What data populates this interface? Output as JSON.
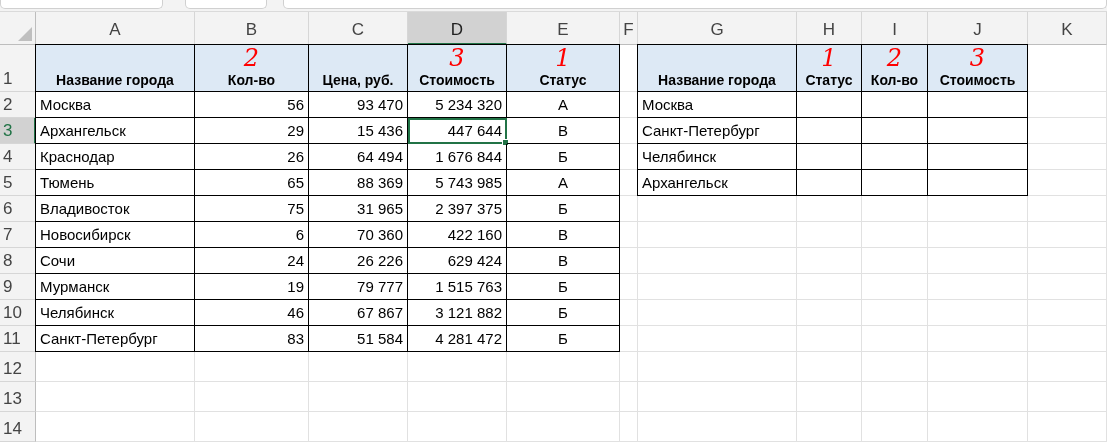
{
  "columns": [
    {
      "label": "A",
      "selected": false
    },
    {
      "label": "B",
      "selected": false
    },
    {
      "label": "C",
      "selected": false
    },
    {
      "label": "D",
      "selected": true
    },
    {
      "label": "E",
      "selected": false
    },
    {
      "label": "F",
      "selected": false
    },
    {
      "label": "G",
      "selected": false
    },
    {
      "label": "H",
      "selected": false
    },
    {
      "label": "I",
      "selected": false
    },
    {
      "label": "J",
      "selected": false
    },
    {
      "label": "K",
      "selected": false
    }
  ],
  "rows": [
    {
      "label": "1",
      "selected": false
    },
    {
      "label": "2",
      "selected": false
    },
    {
      "label": "3",
      "selected": true
    },
    {
      "label": "4",
      "selected": false
    },
    {
      "label": "5",
      "selected": false
    },
    {
      "label": "6",
      "selected": false
    },
    {
      "label": "7",
      "selected": false
    },
    {
      "label": "8",
      "selected": false
    },
    {
      "label": "9",
      "selected": false
    },
    {
      "label": "10",
      "selected": false
    },
    {
      "label": "11",
      "selected": false
    },
    {
      "label": "12",
      "selected": false
    },
    {
      "label": "13",
      "selected": false
    },
    {
      "label": "14",
      "selected": false
    }
  ],
  "tables": [
    {
      "headers": [
        {
          "text": "Название города",
          "kind": "name"
        },
        {
          "text": "Кол-во",
          "kind": "number",
          "mark": "2"
        },
        {
          "text": "Цена, руб.",
          "kind": "number"
        },
        {
          "text": "Стоимость",
          "kind": "number",
          "mark": "3"
        },
        {
          "text": "Статус",
          "kind": "code",
          "mark": "1"
        }
      ],
      "rows": [
        [
          "Москва",
          "56",
          "93 470",
          "5 234 320",
          "А"
        ],
        [
          "Архангельск",
          "29",
          "15 436",
          "447 644",
          "В"
        ],
        [
          "Краснодар",
          "26",
          "64 494",
          "1 676 844",
          "Б"
        ],
        [
          "Тюмень",
          "65",
          "88 369",
          "5 743 985",
          "А"
        ],
        [
          "Владивосток",
          "75",
          "31 965",
          "2 397 375",
          "Б"
        ],
        [
          "Новосибирск",
          "6",
          "70 360",
          "422 160",
          "В"
        ],
        [
          "Сочи",
          "24",
          "26 226",
          "629 424",
          "В"
        ],
        [
          "Мурманск",
          "19",
          "79 777",
          "1 515 763",
          "Б"
        ],
        [
          "Челябинск",
          "46",
          "67 867",
          "3 121 882",
          "Б"
        ],
        [
          "Санкт-Петербург",
          "83",
          "51 584",
          "4 281 472",
          "Б"
        ]
      ]
    },
    {
      "headers": [
        {
          "text": "Название города",
          "kind": "name"
        },
        {
          "text": "Статус",
          "kind": "code",
          "mark": "1"
        },
        {
          "text": "Кол-во",
          "kind": "number",
          "mark": "2"
        },
        {
          "text": "Стоимость",
          "kind": "number",
          "mark": "3"
        }
      ],
      "rows": [
        [
          "Москва",
          "",
          "",
          ""
        ],
        [
          "Санкт-Петербург",
          "",
          "",
          ""
        ],
        [
          "Челябинск",
          "",
          "",
          ""
        ],
        [
          "Архангельск",
          "",
          "",
          ""
        ]
      ]
    }
  ]
}
